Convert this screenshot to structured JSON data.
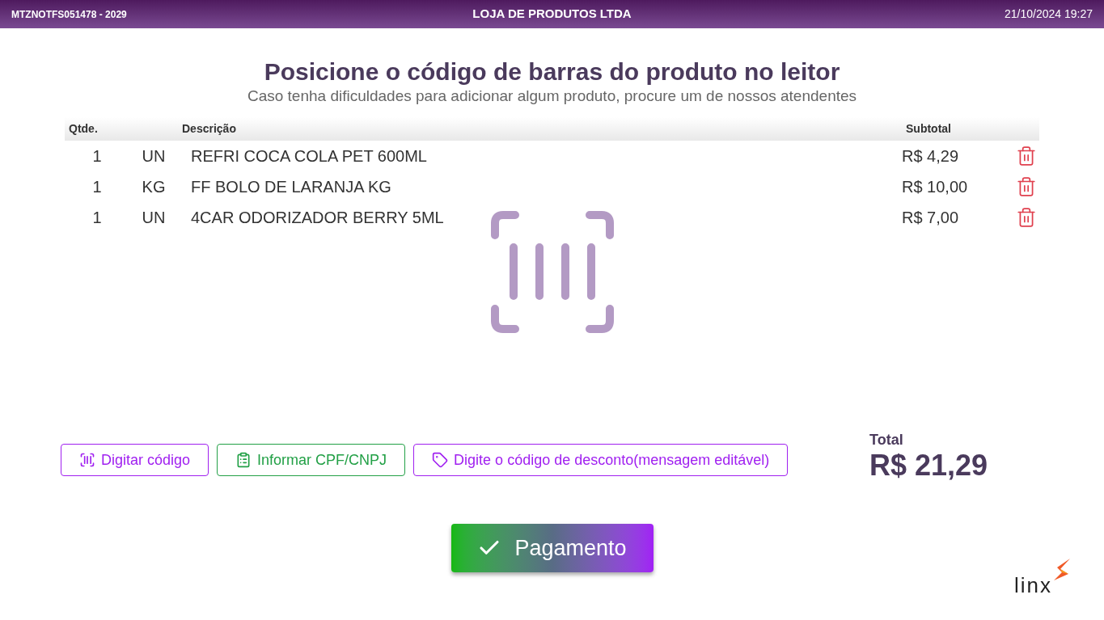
{
  "header": {
    "terminal": "MTZNOTFS051478 - 2029",
    "store": "LOJA DE PRODUTOS LTDA",
    "datetime": "21/10/2024 19:27"
  },
  "title": "Posicione o código de barras do produto no leitor",
  "subtitle": "Caso tenha dificuldades para adicionar algum produto, procure um de nossos atendentes",
  "table": {
    "columns": [
      "Qtde.",
      "Descrição",
      "Subtotal"
    ],
    "rows": [
      {
        "qty": "1",
        "unit": "UN",
        "description": "REFRI COCA COLA PET 600ML",
        "subtotal": "R$ 4,29"
      },
      {
        "qty": "1",
        "unit": "KG",
        "description": "FF BOLO DE LARANJA KG",
        "subtotal": "R$ 10,00"
      },
      {
        "qty": "1",
        "unit": "UN",
        "description": "4CAR ODORIZADOR BERRY 5ML",
        "subtotal": "R$ 7,00"
      }
    ]
  },
  "actions": [
    {
      "kind": "barcode",
      "label": "Digitar código",
      "color": "#a020f0"
    },
    {
      "kind": "badge",
      "label": "Informar CPF/CNPJ",
      "color": "#22a046"
    },
    {
      "kind": "tag",
      "label": "Digite o código de desconto(mensagem editável)",
      "color": "#a020f0"
    }
  ],
  "total": {
    "label": "Total",
    "value": "R$ 21,29"
  },
  "pay_button": "Pagamento",
  "logo": "linx"
}
